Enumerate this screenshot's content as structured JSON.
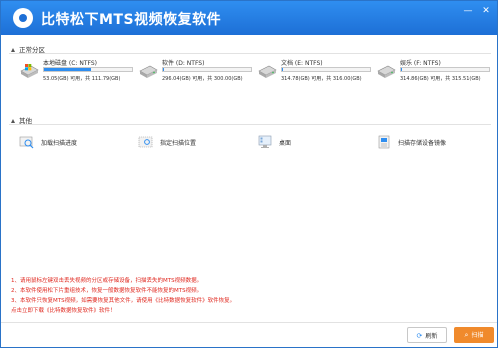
{
  "app": {
    "title": "比特松下MTS视频恢复软件",
    "minimize_glyph": "—",
    "close_glyph": "✕"
  },
  "sections": {
    "partitions": "正常分区",
    "other": "其他"
  },
  "drives": [
    {
      "name": "本地磁盘 (C: NTFS)",
      "info": "53.05(GB) 可用，共 111.79(GB)",
      "used_fraction": 0.53,
      "icon": "windows-drive-icon"
    },
    {
      "name": "软件 (D: NTFS)",
      "info": "296.04(GB) 可用，共 300.00(GB)",
      "used_fraction": 0.01,
      "icon": "hard-drive-icon"
    },
    {
      "name": "文档 (E: NTFS)",
      "info": "314.78(GB) 可用，共 316.00(GB)",
      "used_fraction": 0.01,
      "icon": "hard-drive-icon"
    },
    {
      "name": "娱乐 (F: NTFS)",
      "info": "314.86(GB) 可用，共 315.51(GB)",
      "used_fraction": 0.01,
      "icon": "hard-drive-icon"
    }
  ],
  "others": [
    {
      "label": "加载扫描进度",
      "icon": "load-progress-icon"
    },
    {
      "label": "指定扫描位置",
      "icon": "folder-location-icon"
    },
    {
      "label": "桌面",
      "icon": "desktop-icon"
    },
    {
      "label": "扫描存储设备镜像",
      "icon": "disk-image-icon"
    }
  ],
  "notes": [
    "1、请用鼠标左键双击丢失视频的分区或存储设备，扫描丢失的MTS视频数据。",
    "2、本软件使用松下片重组技术，恢复一般数据恢复软件不能恢复的MTS视频。",
    "3、本软件只恢复MTS视频，如需要恢复其他文件，请使用《比特数据恢复软件》软件恢复。",
    "    点击立即下载《比特数据恢复软件》软件！"
  ],
  "buttons": {
    "refresh": "刷新",
    "scan": "扫描"
  },
  "colors": {
    "titlebar": "#1d6fd6",
    "accent": "#2f8ef0",
    "scan_button": "#f08a2c",
    "note_text": "#e0281f"
  }
}
